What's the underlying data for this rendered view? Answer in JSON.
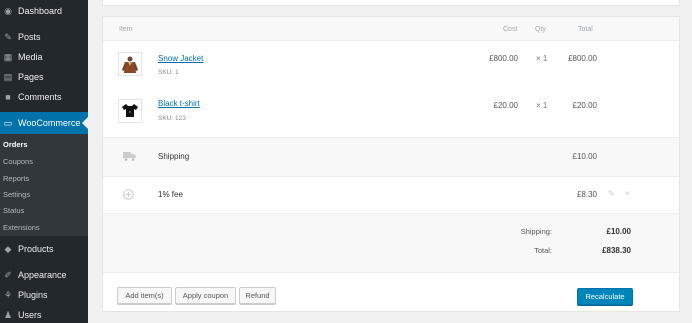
{
  "sidebar": {
    "items": [
      {
        "label": "Dashboard",
        "icon": "dashboard-icon"
      },
      {
        "label": "Posts",
        "icon": "pin-icon"
      },
      {
        "label": "Media",
        "icon": "media-icon"
      },
      {
        "label": "Pages",
        "icon": "pages-icon"
      },
      {
        "label": "Comments",
        "icon": "comments-icon"
      },
      {
        "label": "WooCommerce",
        "icon": "woocommerce-icon"
      },
      {
        "label": "Products",
        "icon": "products-icon"
      },
      {
        "label": "Appearance",
        "icon": "appearance-icon"
      },
      {
        "label": "Plugins",
        "icon": "plugins-icon"
      },
      {
        "label": "Users",
        "icon": "users-icon"
      }
    ],
    "submenu": [
      "Orders",
      "Coupons",
      "Reports",
      "Settings",
      "Status",
      "Extensions"
    ],
    "active": "WooCommerce",
    "current_submenu": "Orders",
    "accent_color": "#0073aa"
  },
  "order_items": {
    "headers": {
      "item": "Item",
      "cost": "Cost",
      "qty": "Qty",
      "total": "Total"
    },
    "items": [
      {
        "name": "Snow Jacket",
        "sku": "SKU: 1",
        "cost": "£800.00",
        "qty": "× 1",
        "total": "£800.00",
        "thumb": "jacket-thumbnail"
      },
      {
        "name": "Black t-shirt",
        "sku": "SKU: 123",
        "cost": "£20.00",
        "qty": "× 1",
        "total": "£20.00",
        "thumb": "tshirt-thumbnail"
      }
    ],
    "shipping": {
      "label": "Shipping",
      "total": "£10.00"
    },
    "fee": {
      "label": "1% fee",
      "total": "£8.30"
    },
    "totals": {
      "shipping_label": "Shipping:",
      "shipping_value": "£10.00",
      "total_label": "Total:",
      "total_value": "£838.30"
    },
    "buttons": {
      "add_items": "Add item(s)",
      "apply_coupon": "Apply coupon",
      "refund": "Refund",
      "recalculate": "Recalculate"
    },
    "primary_button_color": "#0085ba"
  }
}
